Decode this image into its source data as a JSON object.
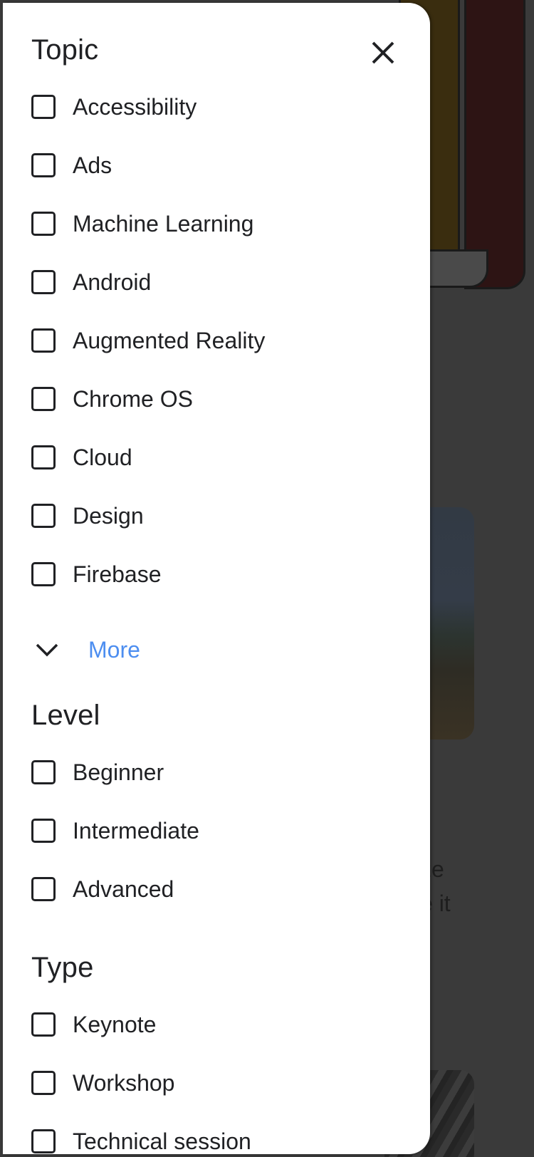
{
  "background": {
    "partial_text": [
      "ze",
      "e it"
    ]
  },
  "drawer": {
    "close_icon": "close-icon",
    "topic": {
      "title": "Topic",
      "options": [
        "Accessibility",
        "Ads",
        "Machine Learning",
        "Android",
        "Augmented Reality",
        "Chrome OS",
        "Cloud",
        "Design",
        "Firebase"
      ],
      "more_label": "More",
      "more_icon": "chevron-down-icon"
    },
    "level": {
      "title": "Level",
      "options": [
        "Beginner",
        "Intermediate",
        "Advanced"
      ]
    },
    "type": {
      "title": "Type",
      "options": [
        "Keynote",
        "Workshop",
        "Technical session"
      ]
    }
  },
  "colors": {
    "link": "#4d8ef0",
    "text": "#202124",
    "scrim": "#3a3a3a"
  }
}
